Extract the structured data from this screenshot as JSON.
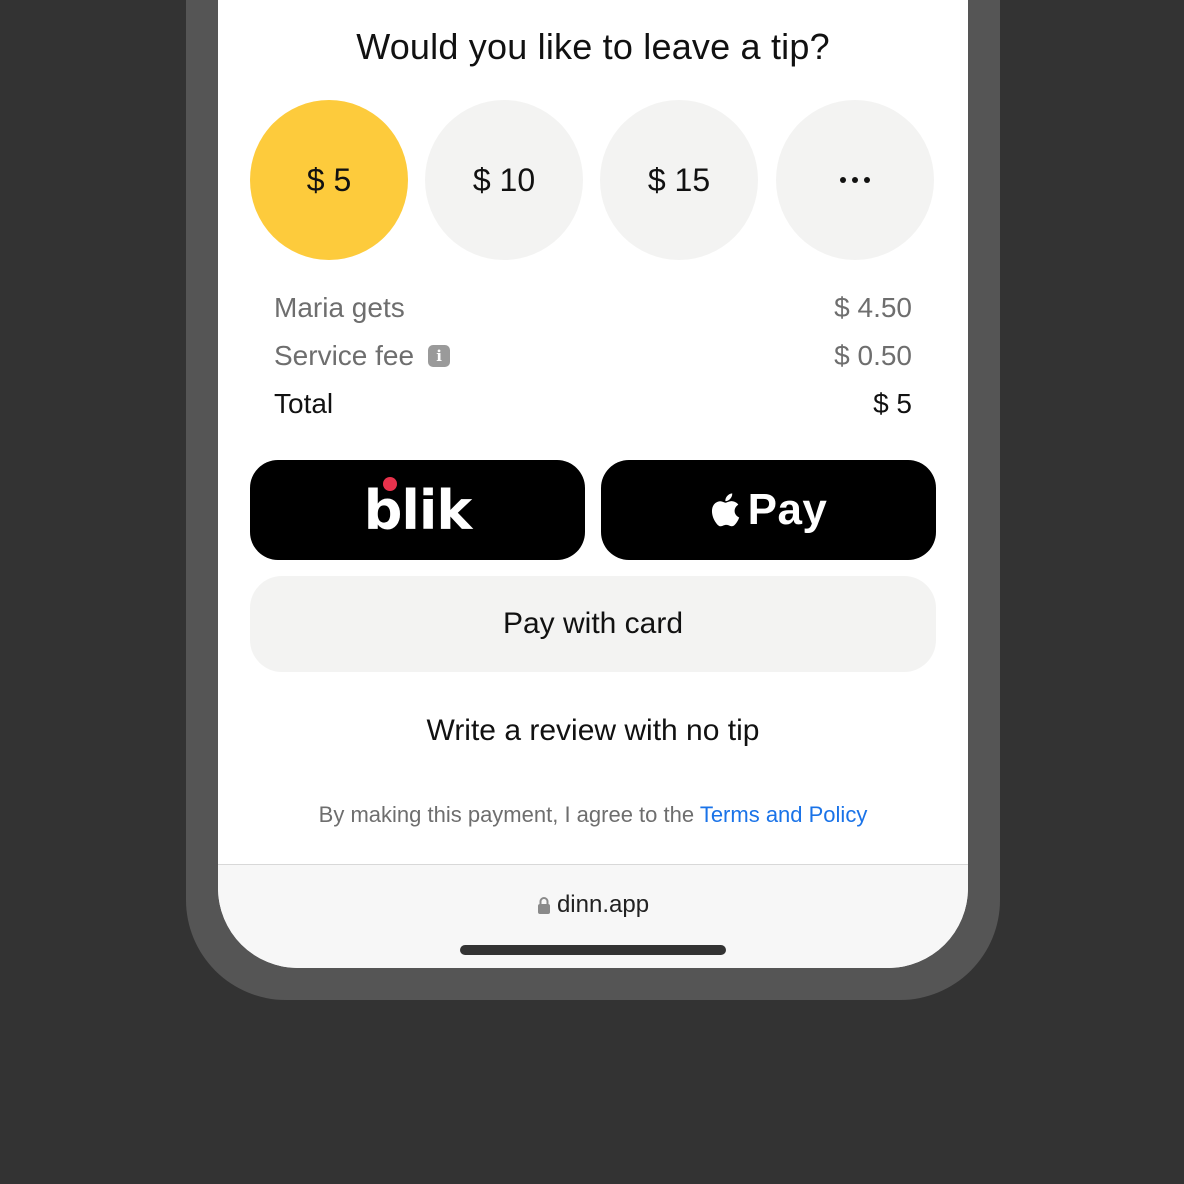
{
  "title": "Would you like to leave a tip?",
  "tips": [
    {
      "label": "$ 5",
      "selected": true
    },
    {
      "label": "$ 10",
      "selected": false
    },
    {
      "label": "$ 15",
      "selected": false
    },
    {
      "label": "more",
      "icon": "more-dots-icon",
      "selected": false
    }
  ],
  "summary": {
    "recipient_label": "Maria gets",
    "recipient_value": "$ 4.50",
    "fee_label": "Service fee",
    "fee_icon": "info-icon",
    "fee_value": "$ 0.50",
    "total_label": "Total",
    "total_value": "$ 5"
  },
  "payment": {
    "blik_text": "blik",
    "apple_pay_text": "Pay",
    "apple_icon": "apple-icon",
    "card_label": "Pay with card"
  },
  "review_link": "Write a review with no tip",
  "terms": {
    "prefix": "By making this payment, I agree to the ",
    "link": "Terms and Policy"
  },
  "browser": {
    "url": "dinn.app",
    "lock_icon": "lock-icon"
  },
  "colors": {
    "selected_tip": "#fdcb3c",
    "link": "#1a73e8",
    "blik_dot": "#e8324c"
  }
}
